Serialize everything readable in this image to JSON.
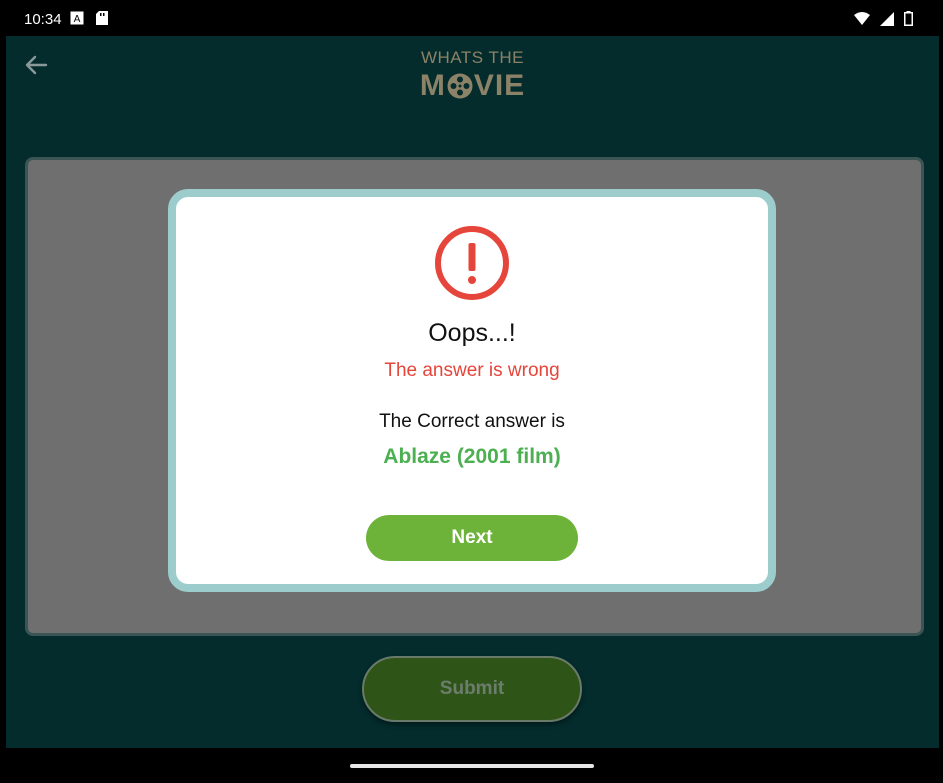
{
  "status_bar": {
    "time": "10:34",
    "left_icons": [
      "notification-a-icon",
      "sd-card-icon"
    ],
    "right_icons": [
      "wifi-icon",
      "signal-icon",
      "battery-icon"
    ]
  },
  "header": {
    "logo_top": "WHATS THE",
    "logo_bottom_left": "M",
    "logo_bottom_right": "VIE",
    "back_icon": "arrow-left-icon"
  },
  "modal": {
    "icon": "alert-circle-icon",
    "title": "Oops...!",
    "subtitle": "The answer is wrong",
    "answer_label": "The Correct answer is",
    "answer_value": "Ablaze (2001 film)",
    "next_label": "Next"
  },
  "submit": {
    "label": "Submit"
  },
  "colors": {
    "app_bg": "#042c2c",
    "card_bg": "#6f6f6f",
    "modal_border": "#9ccccc",
    "error": "#e5453a",
    "success": "#4caf50",
    "next_button": "#6db33a",
    "submit_button": "#2f5418",
    "logo": "#8c8268"
  }
}
